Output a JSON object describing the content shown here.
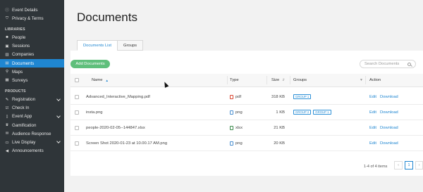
{
  "sidebar": {
    "top_items": [
      {
        "label": "Event Details",
        "icon": "info-icon"
      },
      {
        "label": "Privacy & Terms",
        "icon": "shield-icon"
      }
    ],
    "libraries_title": "LIBRARIES",
    "libraries": [
      {
        "label": "People",
        "icon": "people-icon"
      },
      {
        "label": "Sessions",
        "icon": "calendar-icon"
      },
      {
        "label": "Companies",
        "icon": "building-icon"
      },
      {
        "label": "Documents",
        "icon": "document-icon",
        "active": true
      },
      {
        "label": "Maps",
        "icon": "map-pin-icon"
      },
      {
        "label": "Surveys",
        "icon": "survey-icon"
      }
    ],
    "products_title": "PRODUCTS",
    "products": [
      {
        "label": "Registration",
        "icon": "registration-icon",
        "expandable": true
      },
      {
        "label": "Check In",
        "icon": "checkin-icon"
      },
      {
        "label": "Event App",
        "icon": "mobile-icon",
        "expandable": true
      },
      {
        "label": "Gamification",
        "icon": "trophy-icon"
      },
      {
        "label": "Audience Response",
        "icon": "chat-icon"
      },
      {
        "label": "Live Display",
        "icon": "display-icon",
        "expandable": true
      },
      {
        "label": "Announcements",
        "icon": "megaphone-icon"
      }
    ]
  },
  "page": {
    "title": "Documents",
    "tabs": [
      "Documents List",
      "Groups"
    ],
    "add_button": "Add Documents",
    "search_placeholder": "Search Documents",
    "columns": {
      "name": "Name",
      "type": "Type",
      "size": "Size",
      "groups": "Groups",
      "action": "Action"
    },
    "rows": [
      {
        "name": "Advanced_Interactive_Mapping.pdf",
        "type": "pdf",
        "size": "318 KB",
        "groups": [
          "GROUP 1"
        ],
        "edit": "Edit",
        "download": "Download"
      },
      {
        "name": "insta.png",
        "type": "png",
        "size": "1 KB",
        "groups": [
          "GROUP 2",
          "GROUP 1"
        ],
        "edit": "Edit",
        "download": "Download"
      },
      {
        "name": "people-2020-02-05--144847.xlsx",
        "type": "xlsx",
        "size": "21 KB",
        "groups": [],
        "edit": "Edit",
        "download": "Download"
      },
      {
        "name": "Screen Shot 2020-01-23 at 10.00.17 AM.png",
        "type": "png",
        "size": "20 KB",
        "groups": [],
        "edit": "Edit",
        "download": "Download"
      }
    ],
    "pagination": {
      "info": "1-4 of 4 items",
      "current": "1",
      "prev": "‹",
      "next": "›"
    }
  },
  "colors": {
    "accent": "#1f86d1",
    "sidebar_bg": "#2f3539",
    "add_button": "#5fbf7b"
  }
}
